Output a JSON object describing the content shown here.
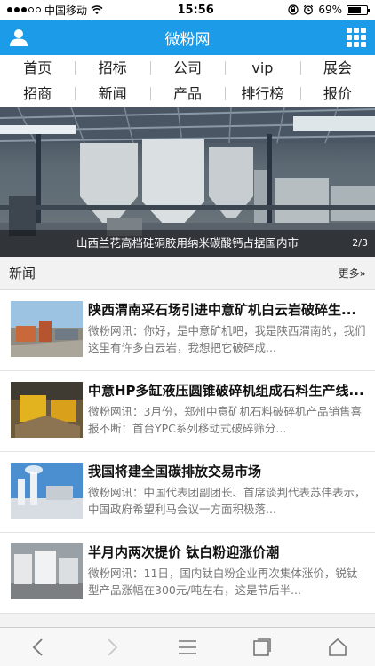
{
  "status": {
    "carrier": "中国移动",
    "time": "15:56",
    "battery": "69%",
    "battery_level": 0.69
  },
  "header": {
    "title": "微粉网"
  },
  "nav": {
    "row1": [
      "首页",
      "招标",
      "公司",
      "vip",
      "展会"
    ],
    "row2": [
      "招商",
      "新闻",
      "产品",
      "排行榜",
      "报价"
    ]
  },
  "banner": {
    "caption": "山西兰花高档硅硐胶用纳米碳酸钙占据国内市",
    "pager": "2/3"
  },
  "news": {
    "section_title": "新闻",
    "more_label": "更多»",
    "items": [
      {
        "title": "陕西渭南采石场引进中意矿机白云岩破碎生...",
        "summary": "微粉网讯：你好，是中意矿机吧，我是陕西渭南的，我们这里有许多白云岩，我想把它破碎成..."
      },
      {
        "title": "中意HP多缸液压圆锥破碎机组成石料生产线...",
        "summary": "微粉网讯：3月份，郑州中意矿机石料破碎机产品销售喜报不断：首台YPC系列移动式破碎筛分..."
      },
      {
        "title": "我国将建全国碳排放交易市场",
        "summary": "微粉网讯：中国代表团副团长、首席谈判代表苏伟表示，中国政府希望利马会议一方面积极落..."
      },
      {
        "title": "半月内两次提价 钛白粉迎涨价潮",
        "summary": "微粉网讯：11日，国内钛白粉企业再次集体涨价，锐钛型产品涨幅在300元/吨左右，这是节后半..."
      }
    ]
  },
  "colors": {
    "brand": "#1b9be8"
  }
}
